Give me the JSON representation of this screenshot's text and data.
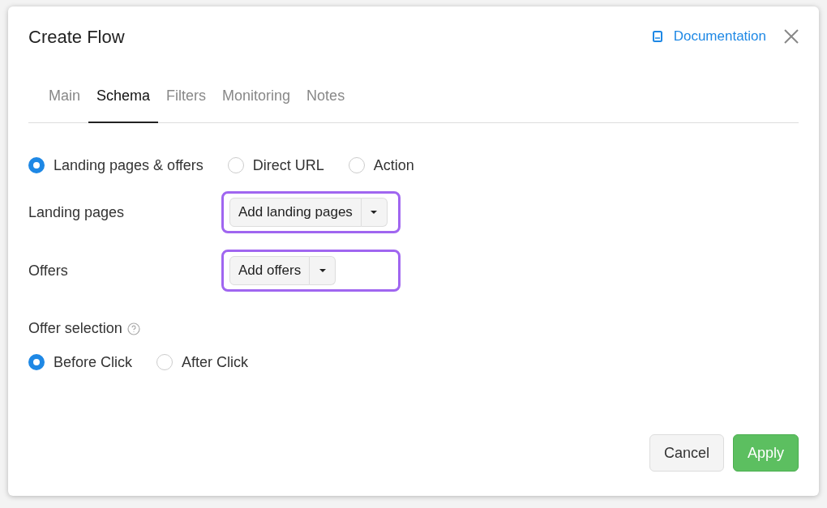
{
  "dialog": {
    "title": "Create Flow",
    "documentation_link": "Documentation"
  },
  "tabs": [
    {
      "label": "Main",
      "selected": false
    },
    {
      "label": "Schema",
      "selected": true
    },
    {
      "label": "Filters",
      "selected": false
    },
    {
      "label": "Monitoring",
      "selected": false
    },
    {
      "label": "Notes",
      "selected": false
    }
  ],
  "schema_type": [
    {
      "label": "Landing pages & offers",
      "selected": true
    },
    {
      "label": "Direct URL",
      "selected": false
    },
    {
      "label": "Action",
      "selected": false
    }
  ],
  "fields": [
    {
      "label": "Landing pages",
      "button": "Add landing pages",
      "highlighted": true
    },
    {
      "label": "Offers",
      "button": "Add offers",
      "highlighted": true
    }
  ],
  "offer_selection": {
    "label": "Offer selection",
    "options": [
      {
        "label": "Before Click",
        "selected": true
      },
      {
        "label": "After Click",
        "selected": false
      }
    ]
  },
  "buttons": [
    {
      "kind": "secondary",
      "label": "Cancel"
    },
    {
      "kind": "primary",
      "label": "Apply"
    }
  ]
}
